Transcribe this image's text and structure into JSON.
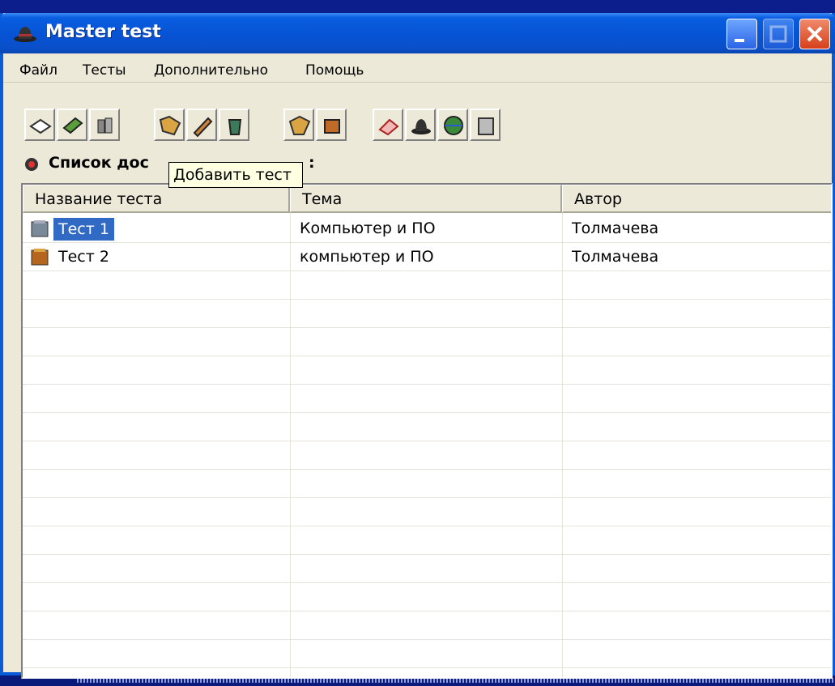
{
  "window": {
    "title": "Master test"
  },
  "menu": [
    "Файл",
    "Тесты",
    "Дополнительно",
    "Помощь"
  ],
  "toolbar": {
    "groups": [
      [
        "open-icon",
        "check-icon",
        "tools-icon"
      ],
      [
        "folder-hand-icon",
        "pencil-icon",
        "trash-icon"
      ],
      [
        "archive-icon",
        "package-icon"
      ],
      [
        "eraser-icon",
        "user-icon",
        "globe-icon",
        "printer-icon"
      ]
    ]
  },
  "list_label": {
    "visible_start": "Список дос",
    "visible_end": ":"
  },
  "tooltip": "Добавить тест",
  "table": {
    "columns": [
      "Название теста",
      "Тема",
      "Автор"
    ],
    "rows": [
      {
        "name": "Тест 1",
        "topic": "Компьютер  и ПО",
        "author": "Толмачева",
        "selected": true,
        "icon": "test-gray-icon"
      },
      {
        "name": "Тест 2",
        "topic": "компьютер и ПО",
        "author": "Толмачева",
        "selected": false,
        "icon": "test-brown-icon"
      }
    ]
  },
  "colors": {
    "titlebar": "#0654d6",
    "selection": "#316ac5",
    "window_bg": "#ece9d8",
    "tooltip_bg": "#ffffe1"
  }
}
